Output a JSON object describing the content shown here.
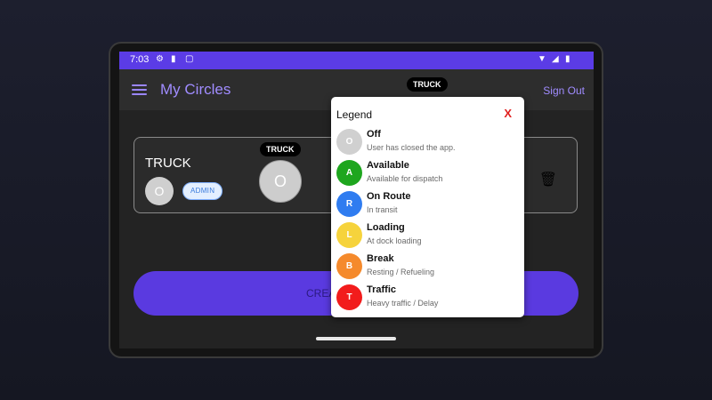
{
  "status_bar": {
    "time": "7:03"
  },
  "app_bar": {
    "title": "My Circles",
    "sign_out": "Sign Out"
  },
  "truck_label": "TRUCK",
  "circle_card": {
    "name": "TRUCK",
    "avatar_letter": "O",
    "role_badge": "ADMIN",
    "marker_label": "TRUCK",
    "marker_letter": "O"
  },
  "create_button": {
    "label": "CREA"
  },
  "legend": {
    "title": "Legend",
    "close": "X",
    "items": [
      {
        "letter": "O",
        "name": "Off",
        "desc": "User has closed the app.",
        "color": "#d0d0d0"
      },
      {
        "letter": "A",
        "name": "Available",
        "desc": "Available for dispatch",
        "color": "#1ea61e"
      },
      {
        "letter": "R",
        "name": "On Route",
        "desc": "In transit",
        "color": "#2f7cf0"
      },
      {
        "letter": "L",
        "name": "Loading",
        "desc": "At dock loading",
        "color": "#f6d33c"
      },
      {
        "letter": "B",
        "name": "Break",
        "desc": "Resting / Refueling",
        "color": "#f58a2c"
      },
      {
        "letter": "T",
        "name": "Traffic",
        "desc": "Heavy traffic / Delay",
        "color": "#f21c1c"
      }
    ]
  },
  "colors": {
    "accent": "#5b3ce6",
    "title": "#a08cff",
    "close": "#e0201f"
  }
}
